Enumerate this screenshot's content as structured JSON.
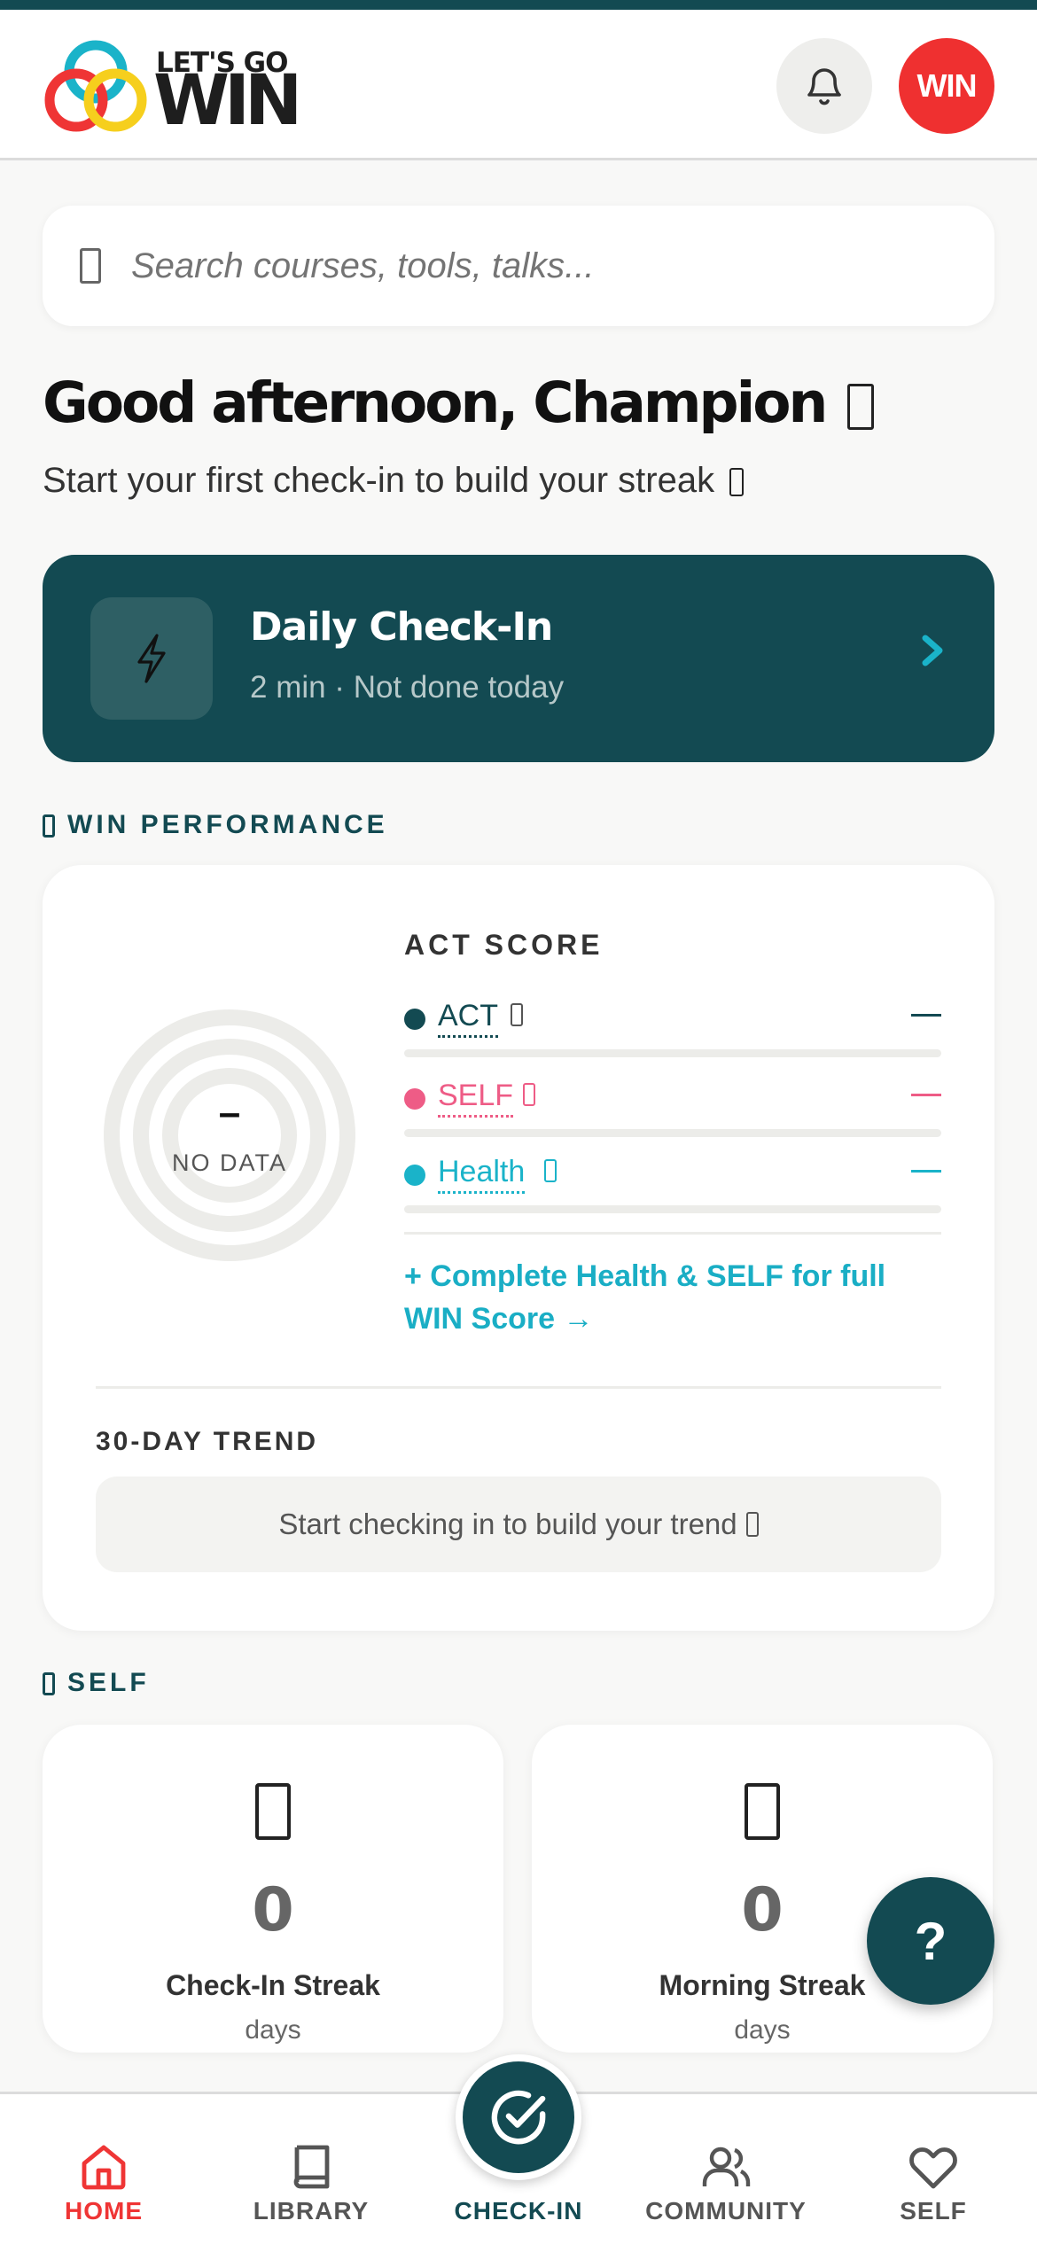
{
  "header": {
    "logo_small": "LET'S GO",
    "logo_big": "WIN",
    "avatar_label": "WIN"
  },
  "search": {
    "placeholder": "Search courses, tools, talks..."
  },
  "greeting": {
    "title": "Good afternoon, Champion",
    "subtitle": "Start your first check-in to build your streak"
  },
  "daily_checkin": {
    "title": "Daily Check-In",
    "subtitle": "2 min · Not done today"
  },
  "win_performance": {
    "section_label": "WIN PERFORMANCE",
    "donut_value": "–",
    "donut_label": "NO DATA",
    "act_score_title": "ACT SCORE",
    "scores": [
      {
        "label": "ACT",
        "value": "—",
        "color": "#134a52",
        "fill": 0
      },
      {
        "label": "SELF",
        "value": "—",
        "color": "#ee5c86",
        "fill": 0
      },
      {
        "label": "Health",
        "value": "—",
        "color": "#1ab3c9",
        "fill": 0
      }
    ],
    "complete_link": "+ Complete Health & SELF for full WIN Score →",
    "trend_title": "30-DAY TREND",
    "trend_empty": "Start checking in to build your trend"
  },
  "self_section": {
    "section_label": "SELF",
    "stats": [
      {
        "value": "0",
        "label": "Check-In Streak",
        "unit": "days"
      },
      {
        "value": "0",
        "label": "Morning Streak",
        "unit": "days"
      }
    ]
  },
  "help_button": "?",
  "nav": {
    "items": [
      {
        "label": "HOME",
        "icon": "home-icon"
      },
      {
        "label": "LIBRARY",
        "icon": "book-icon"
      },
      {
        "label": "CHECK-IN",
        "icon": "check-circle-icon"
      },
      {
        "label": "COMMUNITY",
        "icon": "users-icon"
      },
      {
        "label": "SELF",
        "icon": "heart-icon"
      }
    ]
  },
  "colors": {
    "primary": "#134a52",
    "accent_red": "#ef3030",
    "accent_cyan": "#1aaec5",
    "self_pink": "#ee5c86"
  }
}
